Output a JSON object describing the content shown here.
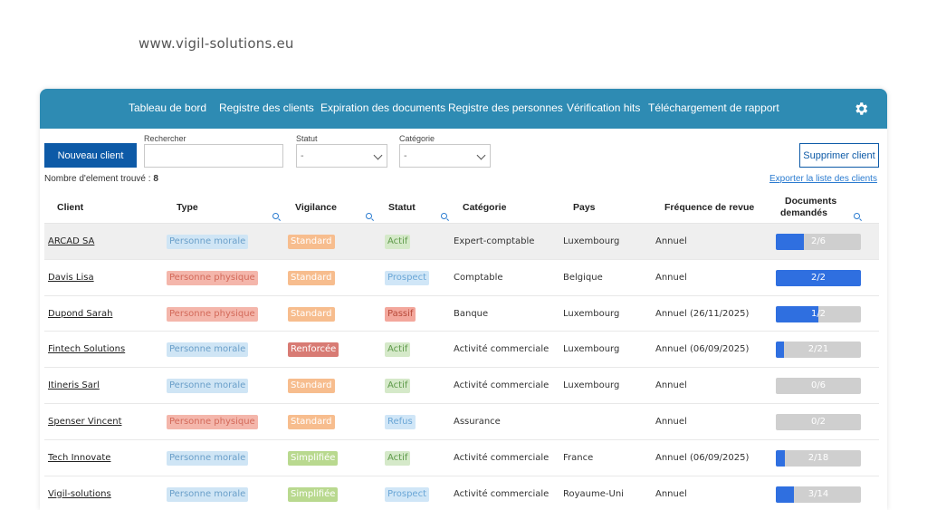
{
  "site_url": "www.vigil-solutions.eu",
  "nav": {
    "items": [
      "Tableau de bord",
      "Registre des clients",
      "Expiration des documents",
      "Registre des personnes",
      "Vérification hits",
      "Téléchargement de rapport"
    ],
    "settings_icon": "gear-icon"
  },
  "toolbar": {
    "new_client_label": "Nouveau client",
    "search_label": "Rechercher",
    "search_value": "",
    "status_label": "Statut",
    "status_value": "-",
    "category_label": "Catégorie",
    "category_value": "-",
    "delete_label": "Supprimer client",
    "export_label": "Exporter la liste des clients",
    "count_label": "Nombre d'element trouvé : ",
    "count_value": "8"
  },
  "table": {
    "headers": [
      "Client",
      "Type",
      "Vigilance",
      "Statut",
      "Catégorie",
      "Pays",
      "Fréquence de revue",
      "Documents",
      "demandés"
    ],
    "rows": [
      {
        "client": "ARCAD SA",
        "type": "Personne morale",
        "type_class": "t-morale",
        "vigilance": "Standard",
        "vig_class": "v-standard",
        "statut": "Actif",
        "stat_class": "s-actif",
        "categorie": "Expert-comptable",
        "pays": "Luxembourg",
        "frequence": "Annuel",
        "docs": "2/6",
        "docs_ratio": 0.333,
        "highlight": true
      },
      {
        "client": "Davis Lisa",
        "type": "Personne physique",
        "type_class": "t-physique",
        "vigilance": "Standard",
        "vig_class": "v-standard",
        "statut": "Prospect",
        "stat_class": "s-prospect",
        "categorie": "Comptable",
        "pays": "Belgique",
        "frequence": "Annuel",
        "docs": "2/2",
        "docs_ratio": 1.0,
        "highlight": false
      },
      {
        "client": "Dupond Sarah",
        "type": "Personne physique",
        "type_class": "t-physique",
        "vigilance": "Standard",
        "vig_class": "v-standard",
        "statut": "Passif",
        "stat_class": "s-passif",
        "categorie": "Banque",
        "pays": "Luxembourg",
        "frequence": "Annuel (26/11/2025)",
        "docs": "1/2",
        "docs_ratio": 0.5,
        "highlight": false
      },
      {
        "client": "Fintech Solutions",
        "type": "Personne morale",
        "type_class": "t-morale",
        "vigilance": "Renforcée",
        "vig_class": "v-renforcee",
        "statut": "Actif",
        "stat_class": "s-actif",
        "categorie": "Activité commerciale",
        "pays": "Luxembourg",
        "frequence": "Annuel (06/09/2025)",
        "docs": "2/21",
        "docs_ratio": 0.095,
        "highlight": false
      },
      {
        "client": "Itineris Sarl",
        "type": "Personne morale",
        "type_class": "t-morale",
        "vigilance": "Standard",
        "vig_class": "v-standard",
        "statut": "Actif",
        "stat_class": "s-actif",
        "categorie": "Activité commerciale",
        "pays": "Luxembourg",
        "frequence": "Annuel",
        "docs": "0/6",
        "docs_ratio": 0,
        "highlight": false
      },
      {
        "client": "Spenser Vincent",
        "type": "Personne physique",
        "type_class": "t-physique",
        "vigilance": "Standard",
        "vig_class": "v-standard",
        "statut": "Refus",
        "stat_class": "s-refus",
        "categorie": "Assurance",
        "pays": "",
        "frequence": "Annuel",
        "docs": "0/2",
        "docs_ratio": 0,
        "highlight": false
      },
      {
        "client": "Tech Innovate",
        "type": "Personne morale",
        "type_class": "t-morale",
        "vigilance": "Simplifiée",
        "vig_class": "v-simplifiee",
        "statut": "Actif",
        "stat_class": "s-actif",
        "categorie": "Activité commerciale",
        "pays": "France",
        "frequence": "Annuel (06/09/2025)",
        "docs": "2/18",
        "docs_ratio": 0.111,
        "highlight": false
      },
      {
        "client": "Vigil-solutions",
        "type": "Personne morale",
        "type_class": "t-morale",
        "vigilance": "Simplifiée",
        "vig_class": "v-simplifiee",
        "statut": "Prospect",
        "stat_class": "s-prospect",
        "categorie": "Activité commerciale",
        "pays": "Royaume-Uni",
        "frequence": "Annuel",
        "docs": "3/14",
        "docs_ratio": 0.214,
        "highlight": false
      }
    ]
  }
}
